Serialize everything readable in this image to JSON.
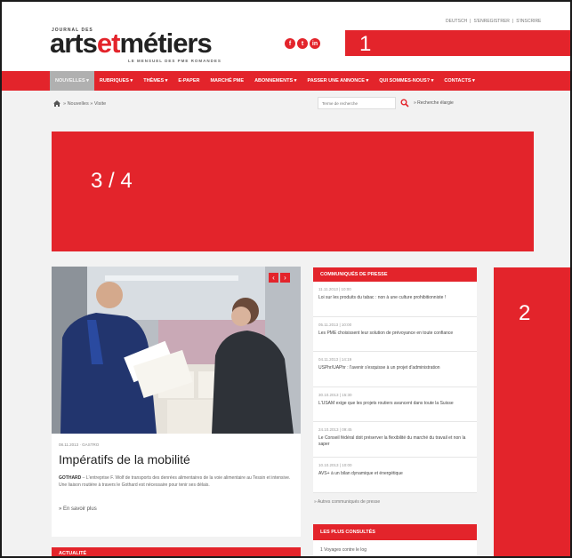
{
  "header": {
    "kicker": "JOURNAL DES",
    "logo_part1": "arts",
    "logo_part2": "et",
    "logo_part3": "métiers",
    "tagline": "LE MENSUEL DES PME ROMANDES",
    "social": [
      "f",
      "t",
      "in"
    ],
    "top_links": [
      "DEUTSCH",
      "S'ENREGISTRER",
      "S'INSCRIRE"
    ]
  },
  "ads": {
    "top": "1",
    "banner": "3 / 4",
    "side": "2"
  },
  "nav": {
    "items": [
      "NOUVELLES ▾",
      "RUBRIQUES ▾",
      "THÈMES ▾",
      "E-PAPER",
      "MARCHÉ PME",
      "ABONNEMENTS ▾",
      "PASSER UNE ANNONCE ▾",
      "QUI SOMMES-NOUS? ▾",
      "CONTACTS ▾"
    ]
  },
  "breadcrumb": {
    "path": "» Nouvelles » Visite"
  },
  "search": {
    "placeholder": "Terme de recherche",
    "advanced_label": "» Recherche élargie"
  },
  "article": {
    "meta": "08.11.2013 · GASTRO",
    "title": "Impératifs de la mobilité",
    "lead_strong": "GOTHARD",
    "lead": " – L'entreprise F. Wolf de transports des denrées alimentaires de la voie alimentaire au Tessin et intensive. Une liaison routière à travers le Gothard est nécessaire pour tenir ses délais.",
    "read_more": "» En savoir plus"
  },
  "press": {
    "heading": "COMMUNIQUÉS DE PRESSE",
    "items": [
      {
        "date": "11.11.2013 | 10:00",
        "text": "Loi sur les produits du tabac : non à une culture prohibitionniste !"
      },
      {
        "date": "05.11.2013 | 10:00",
        "text": "Les PME choisissent leur solution de prévoyance en toute confiance"
      },
      {
        "date": "04.11.2013 | 14:19",
        "text": "USPhr/UAPhr : l'avenir s'esquisse à un projet d'administration"
      },
      {
        "date": "30.10.2013 | 15:30",
        "text": "L'USAM exige que les projets routiers avancent dans toute la Suisse"
      },
      {
        "date": "24.10.2013 | 09:45",
        "text": "Le Conseil fédéral doit préserver la flexibilité du marché du travail et non la saper"
      },
      {
        "date": "10.10.2013 | 10:00",
        "text": "AVS+ à un bilan dynamique et énergétique"
      }
    ],
    "more": "» Autres communiqués de presse"
  },
  "popular": {
    "heading": "LES PLUS CONSULTÉS",
    "first_item": "1 Voyages contre le log"
  },
  "section": {
    "title": "ACTUALITÉ"
  },
  "colors": {
    "brand_red": "#e3242b"
  }
}
